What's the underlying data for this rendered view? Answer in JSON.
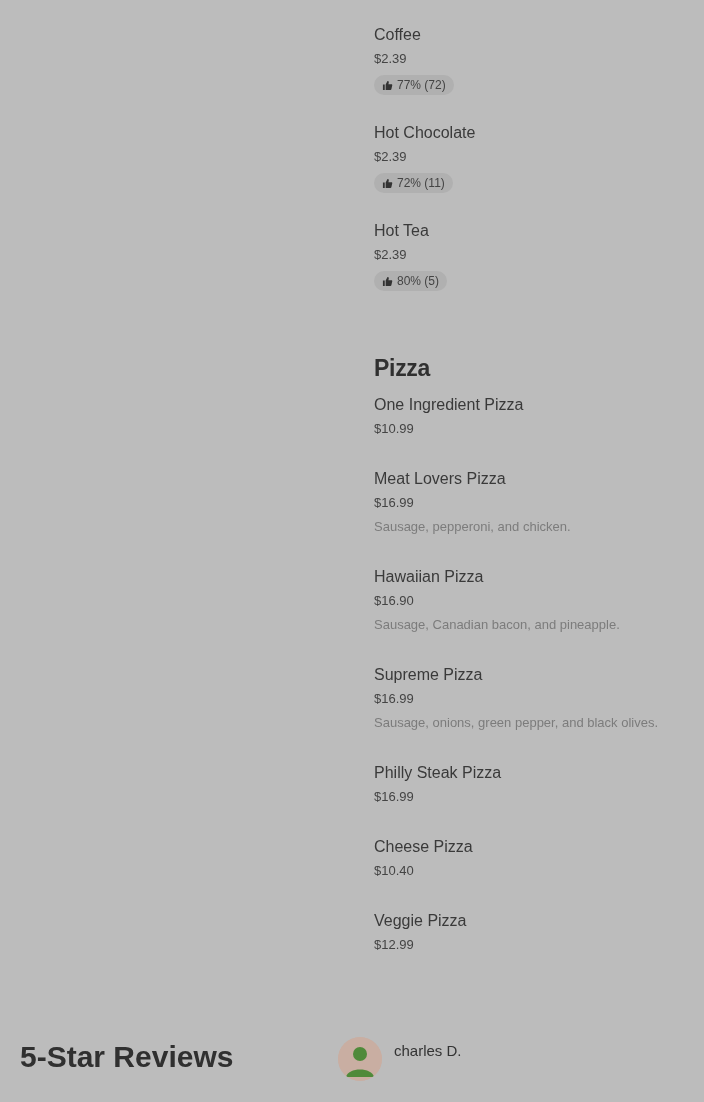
{
  "menu_sections": [
    {
      "items": [
        {
          "name": "Coffee",
          "price": "$2.39",
          "rating": "77% (72)"
        },
        {
          "name": "Hot Chocolate",
          "price": "$2.39",
          "rating": "72% (11)"
        },
        {
          "name": "Hot Tea",
          "price": "$2.39",
          "rating": "80% (5)"
        }
      ]
    },
    {
      "title": "Pizza",
      "items": [
        {
          "name": "One Ingredient Pizza",
          "price": "$10.99"
        },
        {
          "name": "Meat Lovers Pizza",
          "price": "$16.99",
          "description": "Sausage, pepperoni, and chicken."
        },
        {
          "name": "Hawaiian Pizza",
          "price": "$16.90",
          "description": "Sausage, Canadian bacon, and pineapple."
        },
        {
          "name": "Supreme Pizza",
          "price": "$16.99",
          "description": "Sausage, onions, green pepper, and black olives."
        },
        {
          "name": "Philly Steak Pizza",
          "price": "$16.99"
        },
        {
          "name": "Cheese Pizza",
          "price": "$10.40"
        },
        {
          "name": "Veggie Pizza",
          "price": "$12.99"
        }
      ]
    }
  ],
  "reviews": {
    "title": "5-Star Reviews",
    "items": [
      {
        "author": "charles D."
      }
    ]
  }
}
